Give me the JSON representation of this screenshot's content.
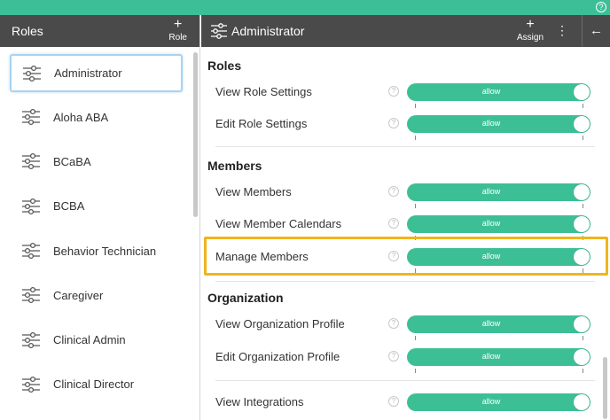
{
  "topbar": {
    "help": "?"
  },
  "left": {
    "title": "Roles",
    "add_plus": "+",
    "add_label": "Role",
    "roles": [
      "Administrator",
      "Aloha ABA",
      "BCaBA",
      "BCBA",
      "Behavior Technician",
      "Caregiver",
      "Clinical Admin",
      "Clinical Director"
    ]
  },
  "right": {
    "title": "Administrator",
    "assign_plus": "+",
    "assign_label": "Assign",
    "more": "⋮",
    "back": "←"
  },
  "sections": [
    {
      "title": "Roles",
      "items": [
        "View Role Settings",
        "Edit Role Settings"
      ]
    },
    {
      "title": "Members",
      "items": [
        "View Members",
        "View Member Calendars",
        "Manage Members"
      ]
    },
    {
      "title": "Organization",
      "items": [
        "View Organization Profile",
        "Edit Organization Profile",
        "View Integrations"
      ]
    }
  ],
  "toggle_text": "allow",
  "help_glyph": "?",
  "colors": {
    "accent": "#3dbf96",
    "header": "#4a4a4a",
    "highlight": "#f0b51c",
    "selected_border": "#a9d3f2"
  }
}
